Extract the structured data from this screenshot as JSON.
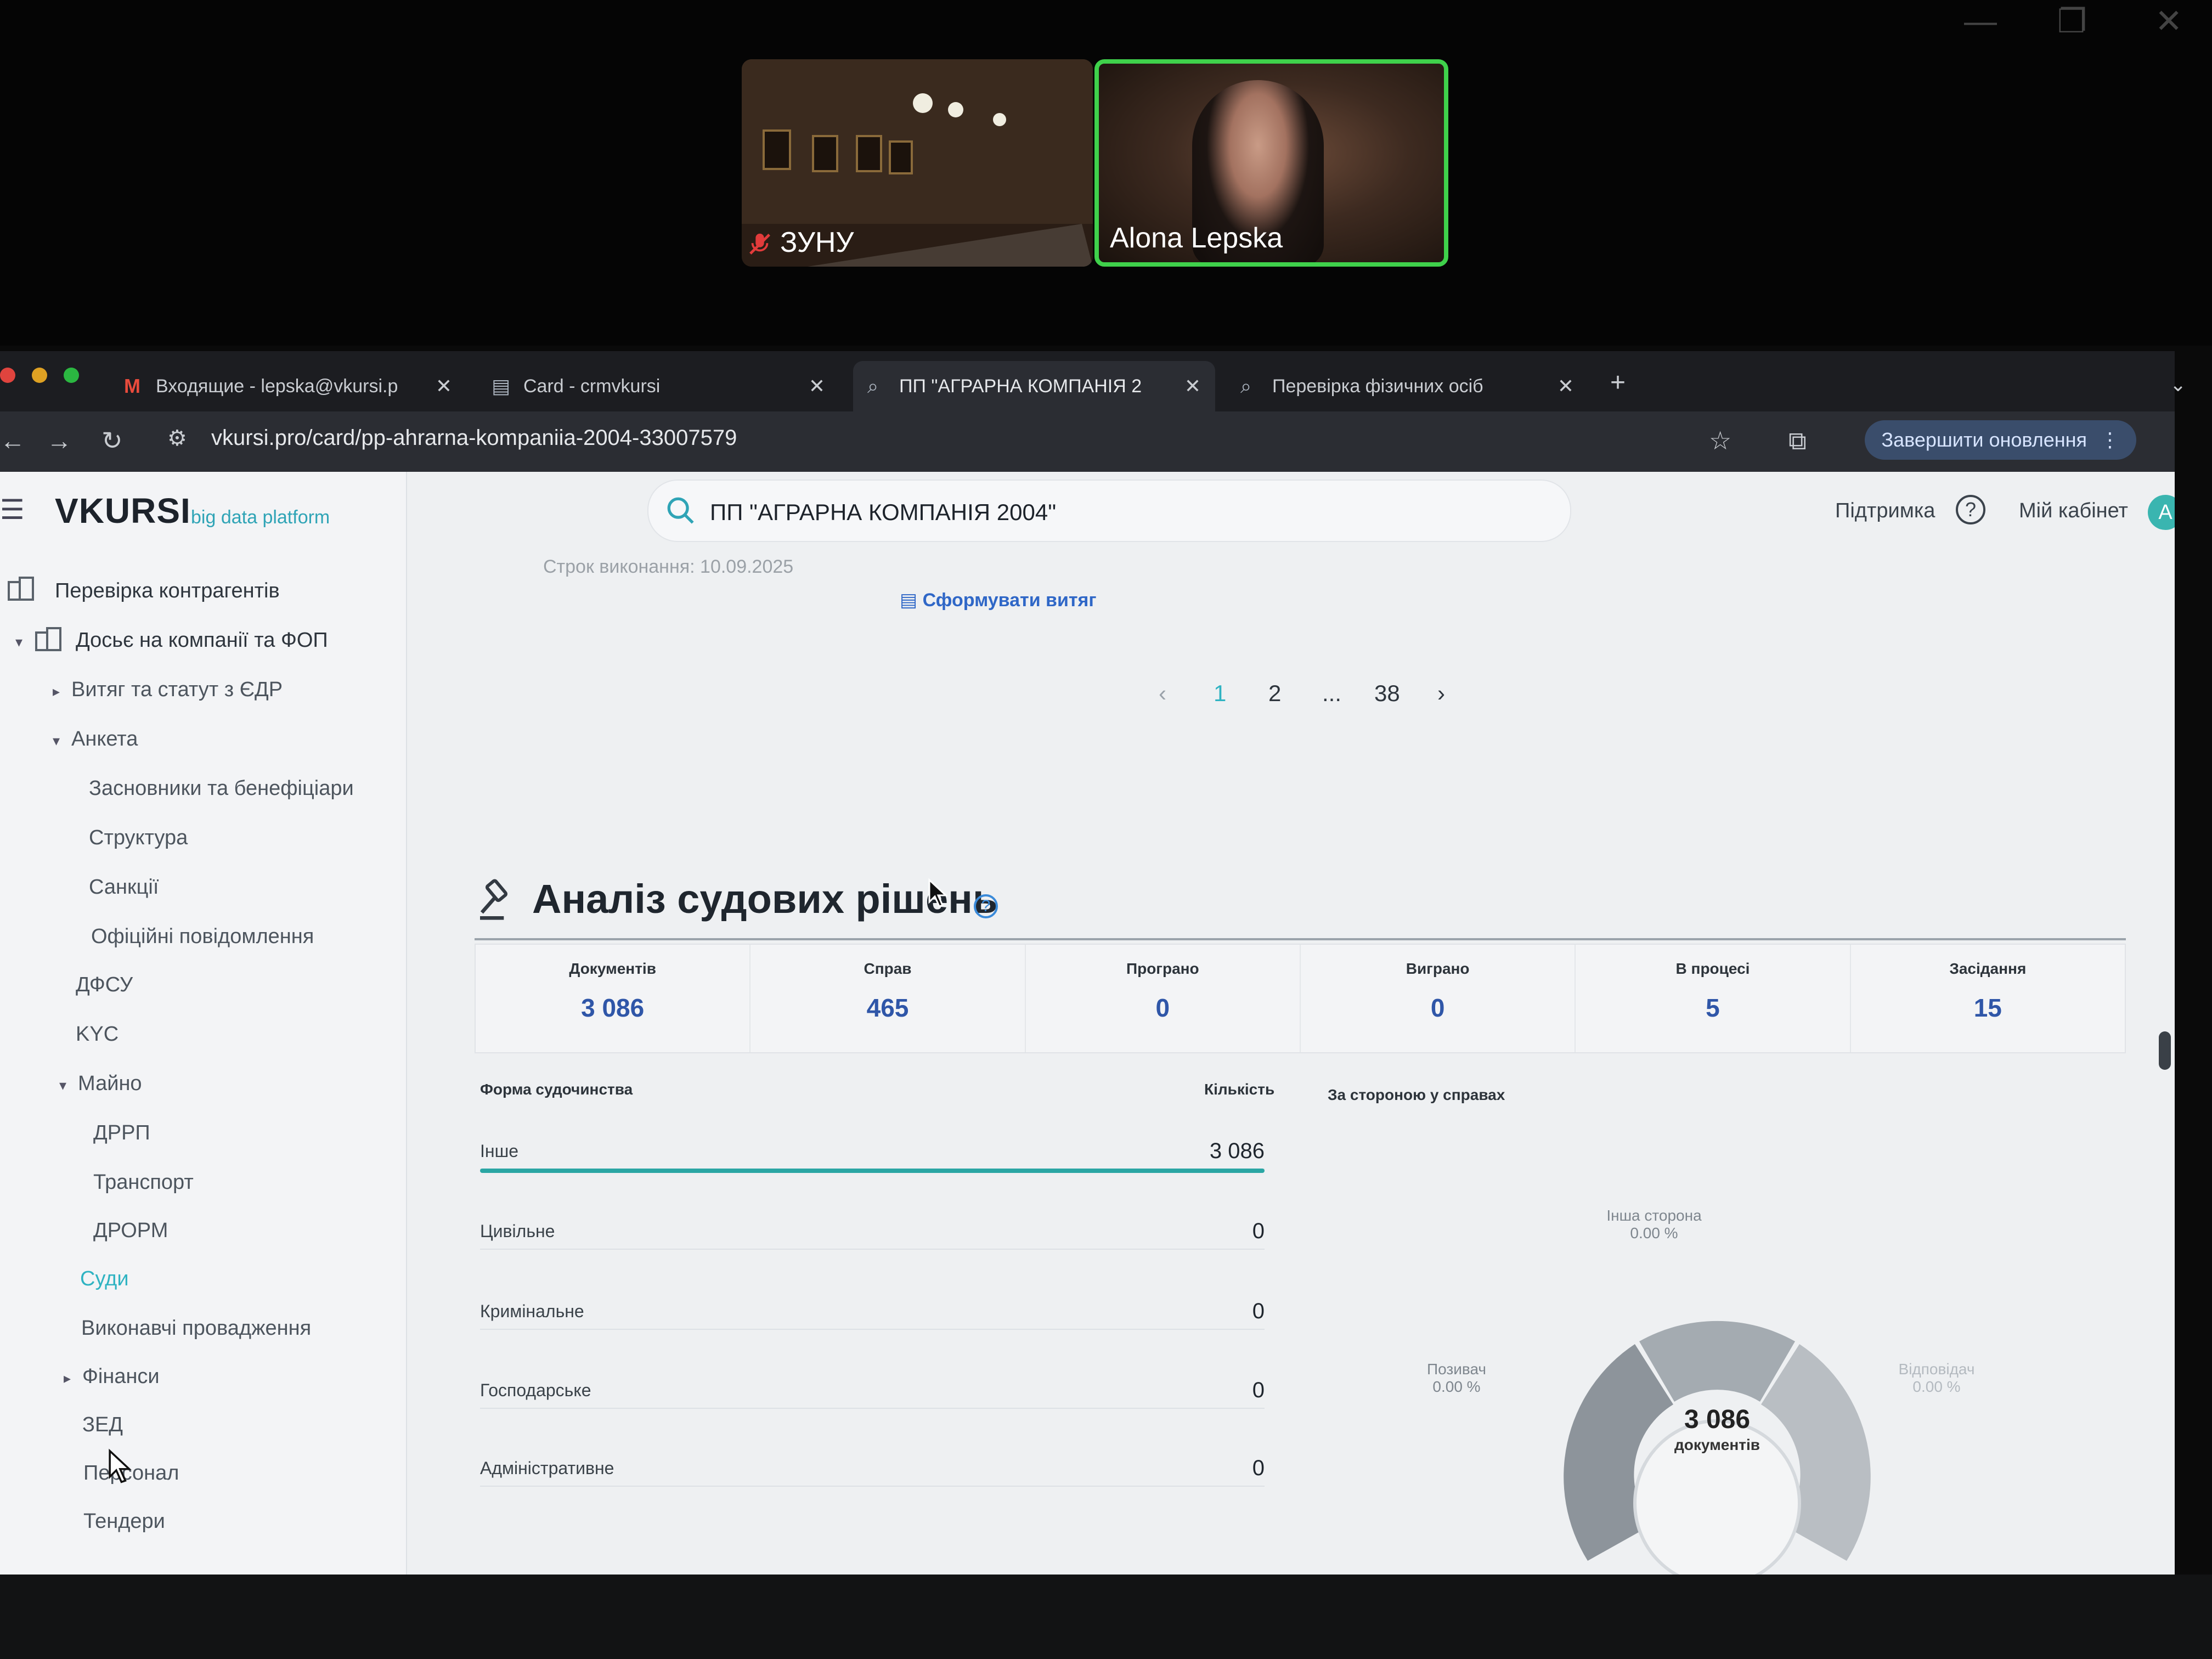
{
  "call": {
    "participants": [
      {
        "name": "ЗУНУ",
        "muted": true
      },
      {
        "name": "Alona Lepska",
        "speaking": true
      }
    ]
  },
  "browser": {
    "tabs": [
      {
        "icon": "gmail-icon",
        "title": "Входящие - lepska@vkursi.p"
      },
      {
        "icon": "document-icon",
        "title": "Card - crmvkursi"
      },
      {
        "icon": "search-icon",
        "title": "ПП \"АГРАРНА КОМПАНІЯ 2",
        "active": true
      },
      {
        "icon": "search-icon",
        "title": "Перевірка фізичних осіб"
      }
    ],
    "new_tab": "+",
    "url": "vkursi.pro/card/pp-ahrarna-kompaniia-2004-33007579",
    "update_button": "Завершити оновлення"
  },
  "header": {
    "logo": "VKURSI",
    "logo_sub": "big data platform",
    "search_value": "ПП \"АГРАРНА КОМПАНІЯ 2004\"",
    "support": "Підтримка",
    "cabinet": "Мій кабінет",
    "avatar": "A"
  },
  "sidebar": {
    "items": [
      {
        "label": "Перевірка контрагентів"
      },
      {
        "label": "Досьє на компанії та ФОП"
      },
      {
        "label": "Витяг та статут з ЄДР"
      },
      {
        "label": "Анкета"
      },
      {
        "label": "Засновники та бенефіціари"
      },
      {
        "label": "Структура"
      },
      {
        "label": "Санкції"
      },
      {
        "label": "Офіційні повідомлення"
      },
      {
        "label": "ДФСУ"
      },
      {
        "label": "KYC"
      },
      {
        "label": "Майно"
      },
      {
        "label": "ДРРП"
      },
      {
        "label": "Транспорт"
      },
      {
        "label": "ДРОРМ"
      },
      {
        "label": "Суди",
        "active": true
      },
      {
        "label": "Виконавчі провадження"
      },
      {
        "label": "Фінанси"
      },
      {
        "label": "ЗЕД"
      },
      {
        "label": "Персонал"
      },
      {
        "label": "Тендери"
      }
    ]
  },
  "top_content": {
    "deadline": "Строк виконання: 10.09.2025",
    "extract_link": "Сформувати витяг"
  },
  "pagination": {
    "prev": "‹",
    "pages": [
      "1",
      "2",
      "...",
      "38"
    ],
    "current": "1",
    "next": "›"
  },
  "court": {
    "title": "Аналіз судових рішень",
    "stats": [
      {
        "label": "Документів",
        "value": "3 086"
      },
      {
        "label": "Справ",
        "value": "465"
      },
      {
        "label": "Програно",
        "value": "0"
      },
      {
        "label": "Виграно",
        "value": "0"
      },
      {
        "label": "В процесі",
        "value": "5"
      },
      {
        "label": "Засідання",
        "value": "15"
      }
    ],
    "forms_header": "Форма судочинства",
    "count_header": "Кількість",
    "side_header": "За стороною у справах",
    "forms": [
      {
        "label": "Інше",
        "value": "3 086",
        "share": 1.0
      },
      {
        "label": "Цивільне",
        "value": "0",
        "share": 0
      },
      {
        "label": "Кримінальне",
        "value": "0",
        "share": 0
      },
      {
        "label": "Господарське",
        "value": "0",
        "share": 0
      },
      {
        "label": "Адміністративне",
        "value": "0",
        "share": 0
      }
    ],
    "donut": {
      "center_value": "3 086",
      "center_label": "документів",
      "segments": [
        {
          "name": "Інша сторона",
          "percent": "0.00 %"
        },
        {
          "name": "Позивач",
          "percent": "0.00 %"
        },
        {
          "name": "Відповідач",
          "percent": "0.00 %"
        }
      ]
    }
  },
  "colors": {
    "accent": "#2fb3c2",
    "link": "#2f67c7",
    "stat_value": "#2f56a8",
    "speaker_border": "#3fd14b"
  }
}
